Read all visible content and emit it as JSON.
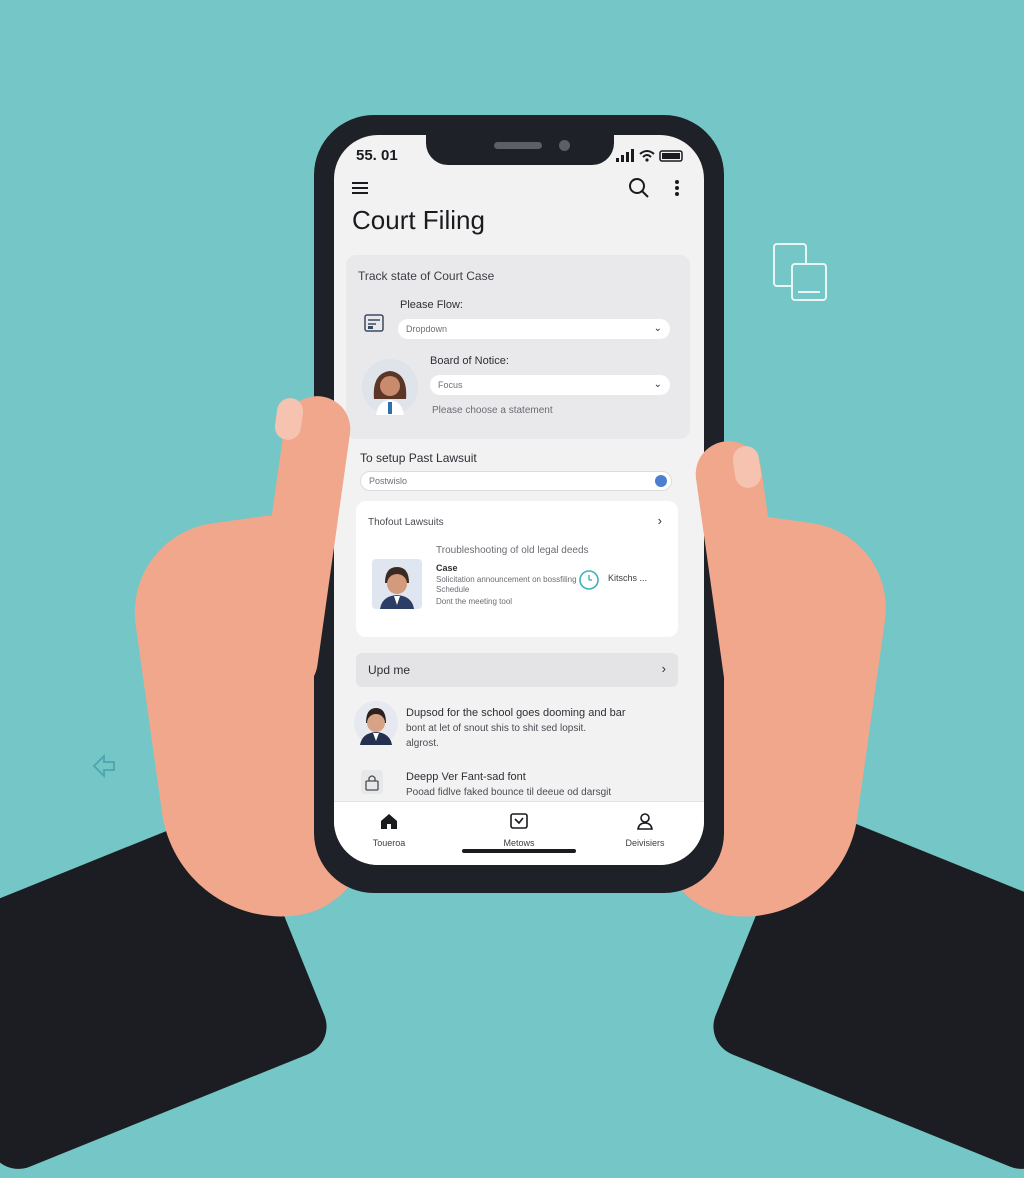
{
  "status_bar": {
    "time": "55. 01"
  },
  "header": {
    "title": "Court Filing"
  },
  "case_panel": {
    "heading": "Track state of Court Case",
    "field1_label": "Please Flow:",
    "field1_value": "Dropdown",
    "field2_label": "Board of Notice:",
    "field2_value": "Focus",
    "field2_note": "Please choose a statement"
  },
  "section2": {
    "title": "To setup Past Lawsuit",
    "search_value": "Postwislo"
  },
  "case_card": {
    "heading": "Thofout Lawsuits",
    "detail_heading": "Troubleshooting of old legal deeds",
    "name": "Case",
    "line1": "Solicitation announcement on bossfiling",
    "line2": "Schedule",
    "line3": "Dont the meeting tool",
    "side_label": "Kitschs ..."
  },
  "updates": {
    "label": "Upd me"
  },
  "messages": [
    {
      "title": "Dupsod for the school goes dooming and bar",
      "body1": "bont at let of snout shis to shit sed lopsit.",
      "body2": "algrost."
    },
    {
      "title": "Deepp Ver Fant-sad font",
      "body1": "Pooad fidlve faked bounce til deeue od darsgit"
    }
  ],
  "bottom_nav": [
    {
      "label": "Toueroa",
      "icon": "home-icon"
    },
    {
      "label": "Metows",
      "icon": "box-icon"
    },
    {
      "label": "Deivisiers",
      "icon": "person-icon"
    }
  ],
  "colors": {
    "background": "#74c7c6",
    "phone": "#1e2127",
    "accent": "#4c7fd0"
  }
}
